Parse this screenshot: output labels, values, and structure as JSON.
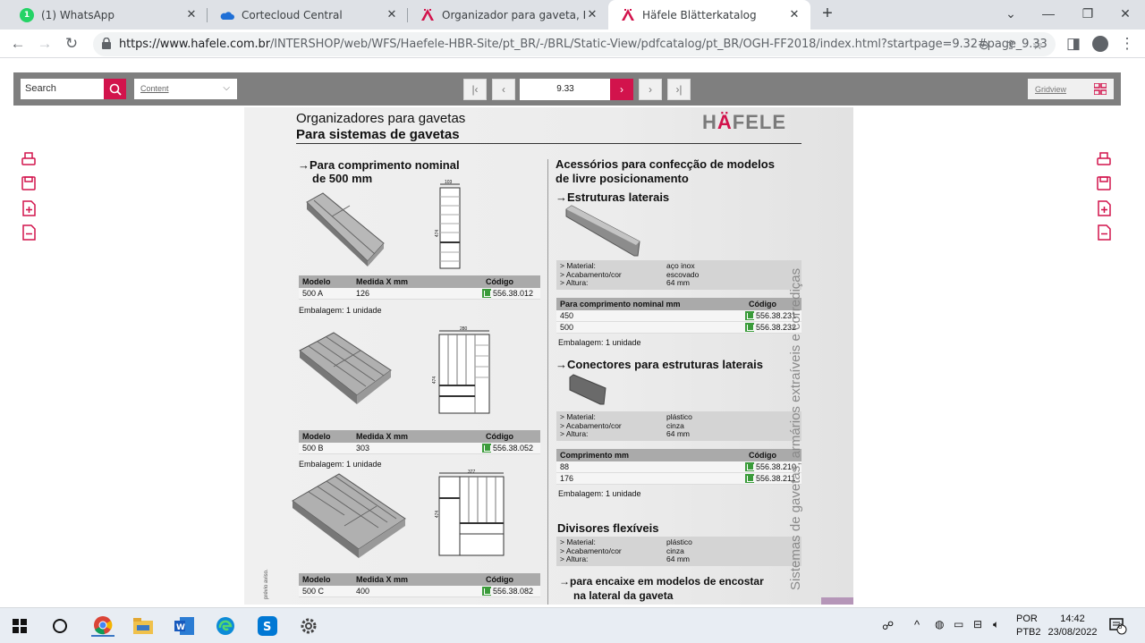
{
  "browser": {
    "tabs": [
      {
        "title": "(1) WhatsApp",
        "icon": "whatsapp-icon",
        "active": false
      },
      {
        "title": "Cortecloud Central",
        "icon": "cloud-icon",
        "active": false
      },
      {
        "title": "Organizador para gaveta, Divinu",
        "icon": "hafele-icon",
        "active": false
      },
      {
        "title": "Häfele Blätterkatalog",
        "icon": "hafele-icon",
        "active": true
      }
    ],
    "new_tab": "+",
    "url_host": "https://www.hafele.com.br",
    "url_path": "/INTERSHOP/web/WFS/Haefele-HBR-Site/pt_BR/-/BRL/Static-View/pdfcatalog/pt_BR/OGH-FF2018/index.html?startpage=9.32#page_9.33"
  },
  "viewer": {
    "search_placeholder": "Search",
    "content_select": "Content",
    "page_number": "9.33",
    "gridview_label": "Gridview"
  },
  "page": {
    "title": "Organizadores para gavetas",
    "subtitle": "Para sistemas de gavetas",
    "logo": {
      "pre": "H",
      "accent": "Ä",
      "post": "FELE"
    },
    "left_heading_1": "→Para comprimento nominal",
    "left_heading_2": "de 500 mm",
    "tables_left": [
      {
        "headers": [
          "Modelo",
          "Medida X mm",
          "Código"
        ],
        "model": "500 A",
        "medida": "126",
        "code": "556.38.012",
        "emb": "Embalagem: 1 unidade",
        "dim_w": "103",
        "dim_h": "474"
      },
      {
        "headers": [
          "Modelo",
          "Medida X mm",
          "Código"
        ],
        "model": "500 B",
        "medida": "303",
        "code": "556.38.052",
        "emb": "Embalagem: 1 unidade",
        "dim_w": "280",
        "dim_h": "474"
      },
      {
        "headers": [
          "Modelo",
          "Medida X mm",
          "Código"
        ],
        "model": "500 C",
        "medida": "400",
        "code": "556.38.082",
        "dim_w": "377",
        "dim_h": "474"
      }
    ],
    "right_heading_1": "Acessórios para confecção de modelos",
    "right_heading_2": "de livre posicionamento",
    "estruturas": {
      "heading": "→Estruturas laterais",
      "specs": [
        [
          "> Material:",
          "aço inox"
        ],
        [
          "> Acabamento/cor",
          "escovado"
        ],
        [
          "> Altura:",
          "64 mm"
        ]
      ],
      "headers": [
        "Para comprimento nominal mm",
        "Código"
      ],
      "rows": [
        [
          "450",
          "556.38.231"
        ],
        [
          "500",
          "556.38.232"
        ]
      ],
      "emb": "Embalagem: 1 unidade"
    },
    "conectores": {
      "heading": "→Conectores para estruturas laterais",
      "specs": [
        [
          "> Material:",
          "plástico"
        ],
        [
          "> Acabamento/cor",
          "cinza"
        ],
        [
          "> Altura:",
          "64 mm"
        ]
      ],
      "headers": [
        "Comprimento mm",
        "Código"
      ],
      "rows": [
        [
          "88",
          "556.38.210"
        ],
        [
          "176",
          "556.38.211"
        ]
      ],
      "emb": "Embalagem: 1 unidade"
    },
    "divisores": {
      "heading": "Divisores flexíveis",
      "specs": [
        [
          "> Material:",
          "plástico"
        ],
        [
          "> Acabamento/cor",
          "cinza"
        ],
        [
          "> Altura:",
          "64 mm"
        ]
      ],
      "sub1": "→para encaixe em modelos de encostar",
      "sub2": "na lateral da gaveta"
    },
    "vertical_text": "Sistemas de gavetas, armários extraíveis e corrediças",
    "tiny_text": "prévio aviso."
  },
  "taskbar": {
    "lang1": "POR",
    "lang2": "PTB2",
    "time": "14:42",
    "date": "23/08/2022",
    "notif_count": "8"
  },
  "colors": {
    "accent": "#d2134c",
    "toolbar_gray": "#7f7f7f",
    "green_code": "#3a9b3a"
  }
}
